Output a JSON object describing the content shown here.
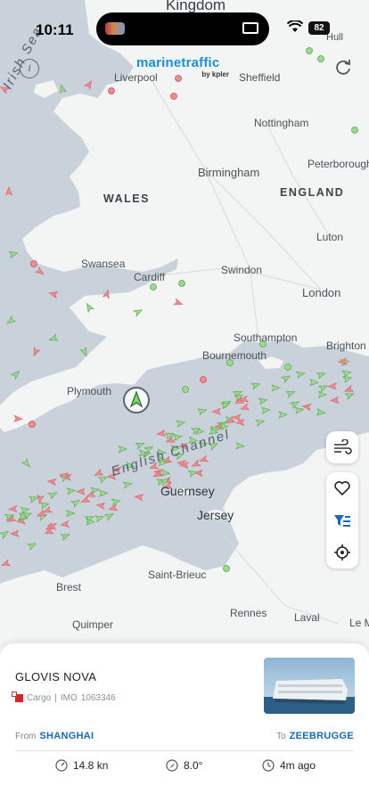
{
  "status_bar": {
    "time": "10:11",
    "battery": "82"
  },
  "app": {
    "brand": "marinetraffic",
    "brand_sub": "by kpler"
  },
  "map": {
    "seas": [
      "Irish Sea",
      "English Channel"
    ],
    "regions": [
      "WALES",
      "ENGLAND"
    ],
    "places": [
      "Kingdom",
      "Liverpool",
      "Hull",
      "Sheffield",
      "Nottingham",
      "Birmingham",
      "Peterborough",
      "Luton",
      "Swansea",
      "Cardiff",
      "Swindon",
      "London",
      "Southampton",
      "Brighton",
      "Bournemouth",
      "Plymouth",
      "Guernsey",
      "Jersey",
      "Saint-Brieuc",
      "Brest",
      "Quimper",
      "Rennes",
      "Laval",
      "Le M"
    ]
  },
  "controls": {
    "info_icon": "info-icon",
    "refresh_icon": "refresh-icon",
    "wind_icon": "wind-icon",
    "favorite_icon": "heart-icon",
    "filter_icon": "filter-icon",
    "locate_icon": "crosshair-icon"
  },
  "vessel": {
    "name": "GLOVIS NOVA",
    "type": "Cargo",
    "imo_label": "IMO",
    "imo": "1063346",
    "from_label": "From",
    "from_port": "SHANGHAI",
    "to_label": "To",
    "to_port": "ZEEBRUGGE",
    "speed": "14.8 kn",
    "course": "8.0°",
    "updated": "4m ago"
  },
  "colors": {
    "accent": "#1769c2",
    "land": "#f3f4f4",
    "sea": "#c9d2da",
    "green_marker": "#9bd98c",
    "red_marker": "#ef8b8f"
  }
}
